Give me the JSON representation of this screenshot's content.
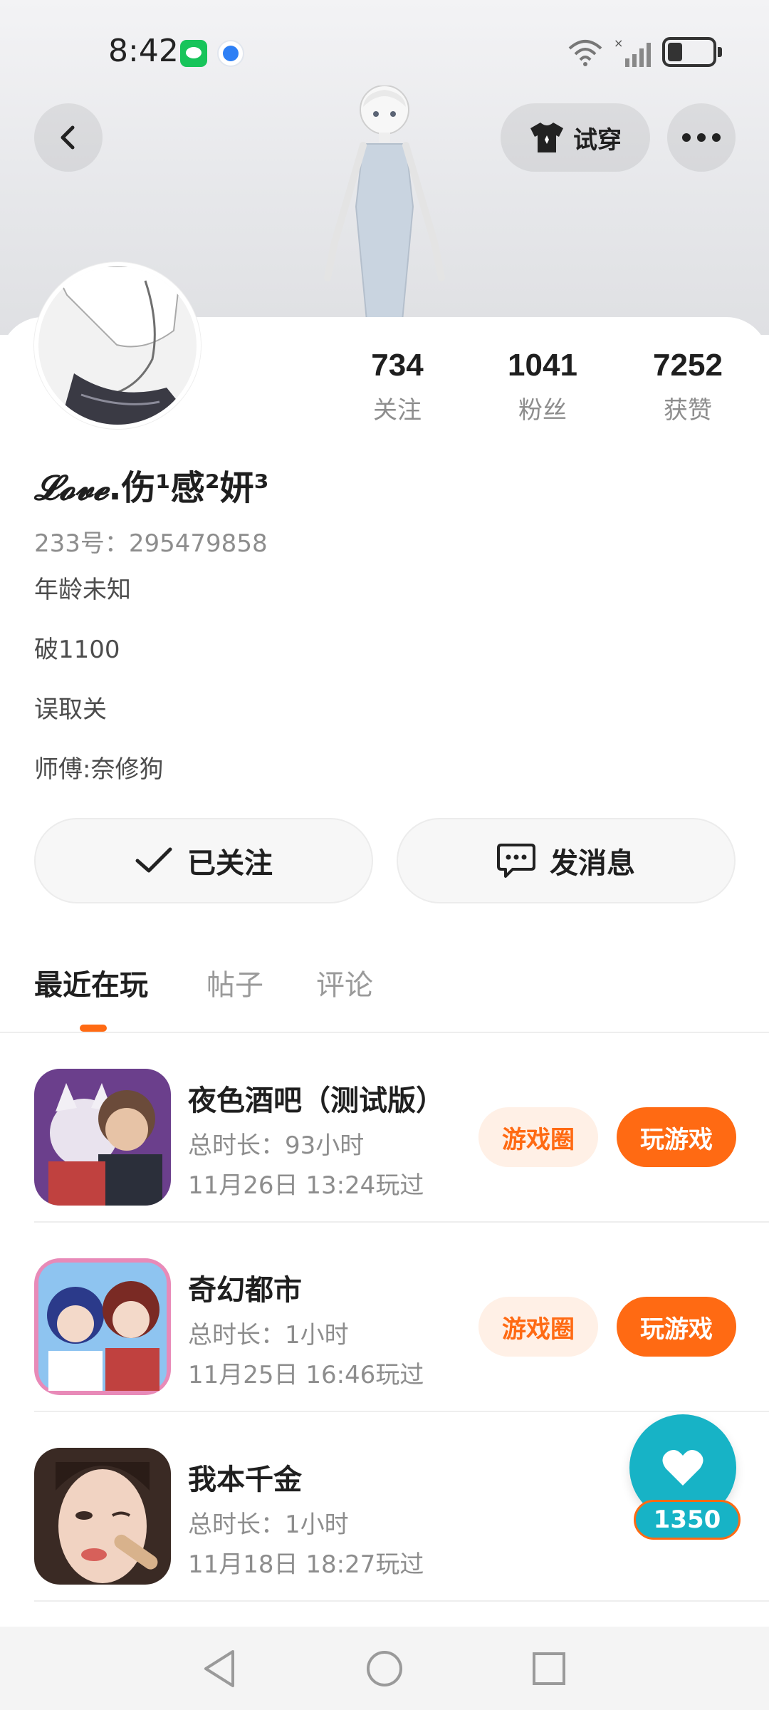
{
  "status_bar": {
    "time": "8:42",
    "icons": [
      "wechat-icon",
      "browser-icon",
      "wifi-icon",
      "signal-icon",
      "battery-icon"
    ]
  },
  "header": {
    "back_icon": "chevron-left-icon",
    "tryon_label": "试穿",
    "more_icon": "more-dots-icon"
  },
  "profile": {
    "stats": [
      {
        "value": "734",
        "label": "关注"
      },
      {
        "value": "1041",
        "label": "粉丝"
      },
      {
        "value": "7252",
        "label": "获赞"
      }
    ],
    "name_prefix": "𝓛𝓸𝓿𝓮",
    "name_main": ".伤¹感²妍³",
    "account_id": "233号：295479858",
    "bio": [
      "年龄未知",
      "破1100",
      "误取关",
      "师傅:奈修狗"
    ]
  },
  "actions": {
    "follow_label": "已关注",
    "message_label": "发消息"
  },
  "tabs": [
    {
      "label": "最近在玩",
      "active": true
    },
    {
      "label": "帖子",
      "active": false
    },
    {
      "label": "评论",
      "active": false
    }
  ],
  "games": [
    {
      "title": "夜色酒吧（测试版）",
      "duration": "总时长：93小时",
      "last_played": "11月26日 13:24玩过",
      "circle_label": "游戏圈",
      "play_label": "玩游戏"
    },
    {
      "title": "奇幻都市",
      "duration": "总时长：1小时",
      "last_played": "11月25日 16:46玩过",
      "circle_label": "游戏圈",
      "play_label": "玩游戏"
    },
    {
      "title": "我本千金",
      "duration": "总时长：1小时",
      "last_played": "11月18日 18:27玩过",
      "circle_label": "",
      "play_label": ""
    }
  ],
  "floating_like": {
    "count": "1350",
    "icon": "heart-icon"
  },
  "colors": {
    "accent": "#ff6a13",
    "accent_soft": "#fff0e6",
    "like_bubble": "#17b3c6"
  }
}
